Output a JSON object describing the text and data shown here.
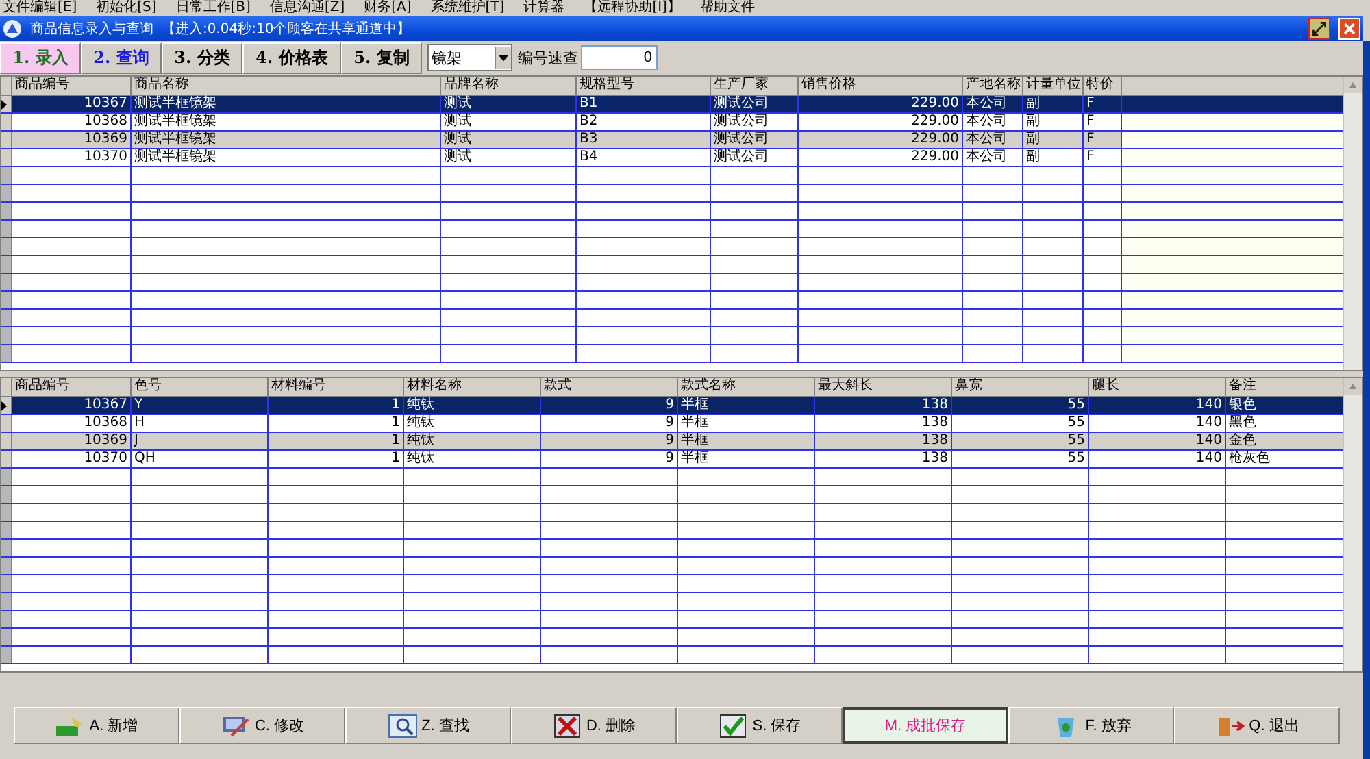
{
  "menu": [
    "文件编辑[E]",
    "初始化[S]",
    "日常工作[B]",
    "信息沟通[Z]",
    "财务[A]",
    "系统维护[T]",
    "计算器",
    "【远程协助[I]】",
    "帮助文件"
  ],
  "window": {
    "title": "商品信息录入与查询",
    "status": "【进入:0.04秒:10个顾客在共享通道中】"
  },
  "tabs": [
    {
      "label": "1. 录入",
      "selected": true,
      "hot": false
    },
    {
      "label": "2. 查询",
      "selected": false,
      "hot": true
    },
    {
      "label": "3. 分类",
      "selected": false,
      "hot": false
    },
    {
      "label": "4. 价格表",
      "selected": false,
      "hot": false
    },
    {
      "label": "5. 复制",
      "selected": false,
      "hot": false
    }
  ],
  "category_select": {
    "value": "镜架"
  },
  "quick_search": {
    "label": "编号速查",
    "value": "0"
  },
  "products_table": {
    "columns": [
      {
        "label": "商品编号"
      },
      {
        "label": "商品名称"
      },
      {
        "label": "品牌名称"
      },
      {
        "label": "规格型号"
      },
      {
        "label": "生产厂家"
      },
      {
        "label": "销售价格"
      },
      {
        "label": "产地名称"
      },
      {
        "label": "计量单位"
      },
      {
        "label": "特价"
      }
    ],
    "rows": [
      {
        "selected": true,
        "cells": [
          "10367",
          "测试半框镜架",
          "测试",
          "B1",
          "测试公司",
          "229.00",
          "本公司",
          "副",
          "F"
        ]
      },
      {
        "selected": false,
        "cells": [
          "10368",
          "测试半框镜架",
          "测试",
          "B2",
          "测试公司",
          "229.00",
          "本公司",
          "副",
          "F"
        ]
      },
      {
        "selected": false,
        "cells": [
          "10369",
          "测试半框镜架",
          "测试",
          "B3",
          "测试公司",
          "229.00",
          "本公司",
          "副",
          "F"
        ]
      },
      {
        "selected": false,
        "cells": [
          "10370",
          "测试半框镜架",
          "测试",
          "B4",
          "测试公司",
          "229.00",
          "本公司",
          "副",
          "F"
        ]
      }
    ]
  },
  "details_table": {
    "columns": [
      {
        "label": "商品编号"
      },
      {
        "label": "色号"
      },
      {
        "label": "材料编号"
      },
      {
        "label": "材料名称"
      },
      {
        "label": "款式"
      },
      {
        "label": "款式名称"
      },
      {
        "label": "最大斜长"
      },
      {
        "label": "鼻宽"
      },
      {
        "label": "腿长"
      },
      {
        "label": "备注"
      }
    ],
    "rows": [
      {
        "selected": true,
        "cells": [
          "10367",
          "Y",
          "1",
          "纯钛",
          "9",
          "半框",
          "138",
          "55",
          "140",
          "银色"
        ]
      },
      {
        "selected": false,
        "cells": [
          "10368",
          "H",
          "1",
          "纯钛",
          "9",
          "半框",
          "138",
          "55",
          "140",
          "黑色"
        ]
      },
      {
        "selected": false,
        "cells": [
          "10369",
          "J",
          "1",
          "纯钛",
          "9",
          "半框",
          "138",
          "55",
          "140",
          "金色"
        ]
      },
      {
        "selected": false,
        "cells": [
          "10370",
          "QH",
          "1",
          "纯钛",
          "9",
          "半框",
          "138",
          "55",
          "140",
          "枪灰色"
        ]
      }
    ]
  },
  "buttons": [
    {
      "label": "A. 新增",
      "default": false
    },
    {
      "label": "C. 修改",
      "default": false
    },
    {
      "label": "Z. 查找",
      "default": false
    },
    {
      "label": "D. 删除",
      "default": false
    },
    {
      "label": "S. 保存",
      "default": false
    },
    {
      "label": "M. 成批保存",
      "default": true
    },
    {
      "label": "F. 放弃",
      "default": false
    },
    {
      "label": "Q. 退出",
      "default": false
    }
  ]
}
